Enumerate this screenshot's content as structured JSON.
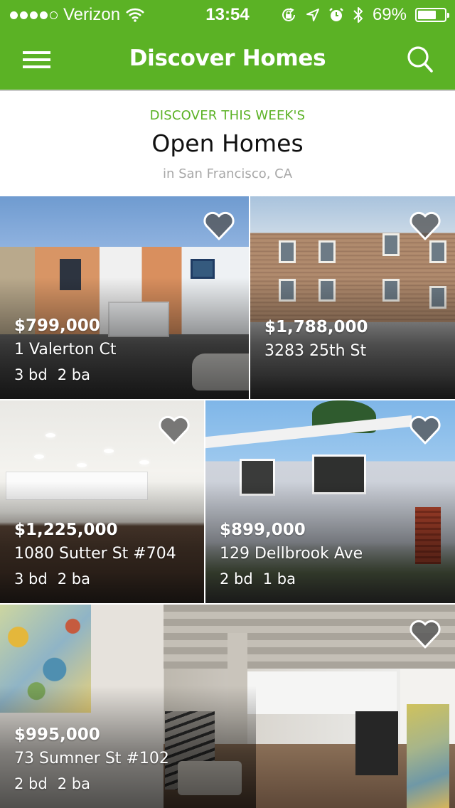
{
  "status_bar": {
    "signal_bars_filled": 4,
    "signal_bars_total": 5,
    "carrier": "Verizon",
    "time": "13:54",
    "icons": [
      "wifi-icon",
      "rotation-lock-icon",
      "location-arrow-icon",
      "alarm-clock-icon",
      "bluetooth-icon"
    ],
    "battery_percent_label": "69%",
    "battery_level": 0.69
  },
  "nav": {
    "title": "Discover Homes",
    "menu_icon": "hamburger-menu-icon",
    "search_icon": "search-icon"
  },
  "hero": {
    "eyebrow": "DISCOVER THIS WEEK'S",
    "headline": "Open Homes",
    "location": "in San Francisco, CA"
  },
  "colors": {
    "brand_green": "#5bb225",
    "text_dark": "#111111",
    "text_muted": "#a8a8a8",
    "white": "#ffffff"
  },
  "listings": [
    {
      "price": "$799,000",
      "address": "1 Valerton Ct",
      "beds": "3 bd",
      "baths": "2 ba",
      "favorite_icon": "heart-icon",
      "favorited": false
    },
    {
      "price": "$1,788,000",
      "address": "3283 25th St",
      "beds": null,
      "baths": null,
      "favorite_icon": "heart-icon",
      "favorited": false
    },
    {
      "price": "$1,225,000",
      "address": "1080 Sutter St #704",
      "beds": "3 bd",
      "baths": "2 ba",
      "favorite_icon": "heart-icon",
      "favorited": false
    },
    {
      "price": "$899,000",
      "address": "129 Dellbrook Ave",
      "beds": "2 bd",
      "baths": "1 ba",
      "favorite_icon": "heart-icon",
      "favorited": false
    },
    {
      "price": "$995,000",
      "address": "73 Sumner St #102",
      "beds": "2 bd",
      "baths": "2 ba",
      "favorite_icon": "heart-icon",
      "favorited": false
    }
  ]
}
